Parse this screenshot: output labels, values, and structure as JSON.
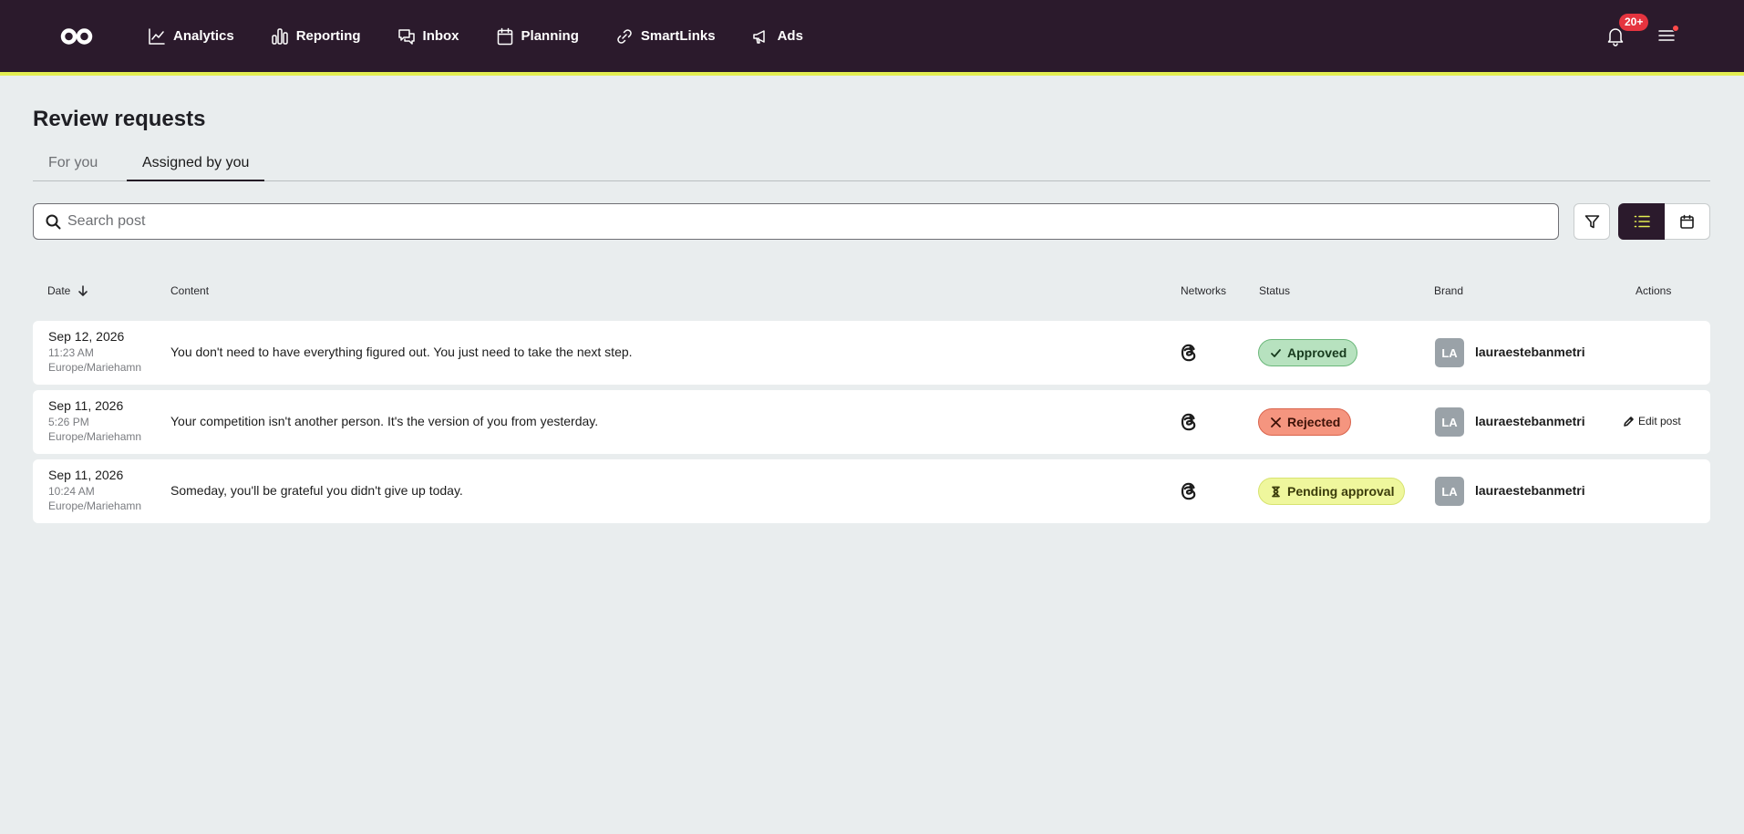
{
  "header": {
    "nav": [
      {
        "label": "Analytics",
        "icon": "analytics-chart-icon"
      },
      {
        "label": "Reporting",
        "icon": "reporting-bars-icon"
      },
      {
        "label": "Inbox",
        "icon": "inbox-chat-icon"
      },
      {
        "label": "Planning",
        "icon": "planning-calendar-icon"
      },
      {
        "label": "SmartLinks",
        "icon": "link-icon"
      },
      {
        "label": "Ads",
        "icon": "megaphone-icon"
      }
    ],
    "notification_count": "20+"
  },
  "page": {
    "title": "Review requests",
    "tabs": [
      {
        "label": "For you",
        "active": false
      },
      {
        "label": "Assigned by you",
        "active": true
      }
    ]
  },
  "search": {
    "placeholder": "Search post",
    "value": ""
  },
  "table": {
    "columns": {
      "date": "Date",
      "content": "Content",
      "networks": "Networks",
      "status": "Status",
      "brand": "Brand",
      "actions": "Actions"
    },
    "rows": [
      {
        "date": "Sep 12, 2026",
        "time": "11:23 AM",
        "timezone": "Europe/Mariehamn",
        "content": "You don't need to have everything figured out. You just need to take the next step.",
        "network": "threads-icon",
        "status": "Approved",
        "brand_initials": "LA",
        "brand_name": "lauraestebanmetri",
        "action": ""
      },
      {
        "date": "Sep 11, 2026",
        "time": "5:26 PM",
        "timezone": "Europe/Mariehamn",
        "content": "Your competition isn't another person. It's the version of you from yesterday.",
        "network": "threads-icon",
        "status": "Rejected",
        "brand_initials": "LA",
        "brand_name": "lauraestebanmetri",
        "action": "Edit post"
      },
      {
        "date": "Sep 11, 2026",
        "time": "10:24 AM",
        "timezone": "Europe/Mariehamn",
        "content": "Someday, you'll be grateful you didn't give up today.",
        "network": "threads-icon",
        "status": "Pending approval",
        "brand_initials": "LA",
        "brand_name": "lauraestebanmetri",
        "action": ""
      }
    ]
  },
  "colors": {
    "topbar": "#2b1a2c",
    "accent": "#e3ee52",
    "approved": "#b7e2bf",
    "rejected": "#f5957f",
    "pending": "#eff79d",
    "badge": "#e5343f"
  }
}
